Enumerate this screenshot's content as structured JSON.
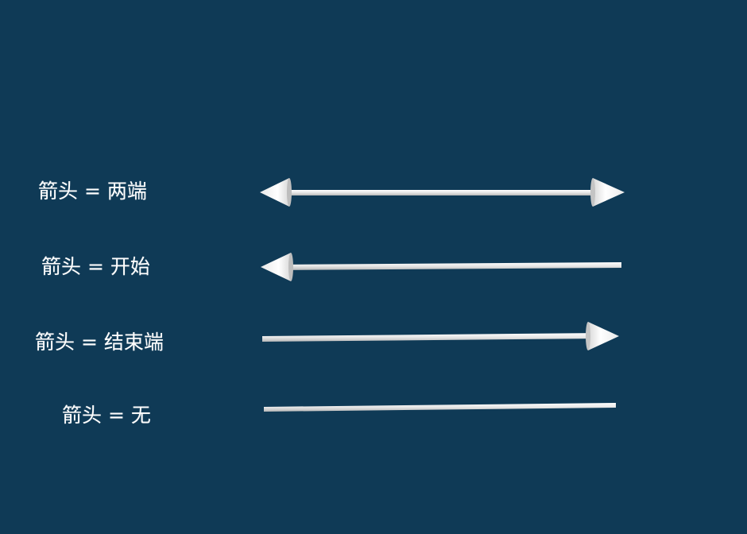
{
  "rows": [
    {
      "label": "箭头 = 两端",
      "arrowhead": "both"
    },
    {
      "label": "箭头 = 开始",
      "arrowhead": "start"
    },
    {
      "label": "箭头 = 结束端",
      "arrowhead": "end"
    },
    {
      "label": "箭头 = 无",
      "arrowhead": "none"
    }
  ],
  "colors": {
    "background": "#0f3a56",
    "arrow": "#f2f2f2",
    "text": "#ffffff"
  }
}
